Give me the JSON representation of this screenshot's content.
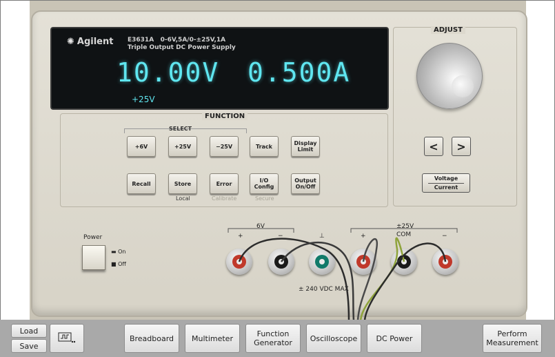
{
  "instrument": {
    "brand": "Agilent",
    "model": "E3631A",
    "spec": "0-6V,5A/0-±25V,1A",
    "subtitle": "Triple Output DC Power Supply",
    "voltage_readout": "10.00V",
    "current_readout": "0.500A",
    "channel": "+25V",
    "function_title": "FUNCTION",
    "select_title": "SELECT",
    "buttons": {
      "p6v": "+6V",
      "p25v": "+25V",
      "m25v": "−25V",
      "track": "Track",
      "display_limit": "Display Limit",
      "recall": "Recall",
      "store": "Store",
      "error": "Error",
      "io_config": "I/O Config",
      "output_onoff": "Output On/Off"
    },
    "sublabels": {
      "local": "Local",
      "calibrate": "Calibrate",
      "secure": "Secure"
    },
    "adjust_title": "ADJUST",
    "arrow_left": "<",
    "arrow_right": ">",
    "voltage_label": "Voltage",
    "current_label": "Current",
    "power": {
      "label": "Power",
      "on": "On",
      "off": "Off"
    },
    "terminals": {
      "six_v": "6V",
      "twentyfive_v": "±25V",
      "com": "COM",
      "plus": "+",
      "minus": "−",
      "ground": "⊥",
      "rating": "±  240 VDC MAX"
    }
  },
  "toolbar": {
    "load": "Load",
    "save": "Save",
    "breadboard": "Breadboard",
    "multimeter": "Multimeter",
    "function_generator": "Function Generator",
    "oscilloscope": "Oscilloscope",
    "dc_power": "DC Power",
    "perform_measurement": "Perform Measurement"
  }
}
